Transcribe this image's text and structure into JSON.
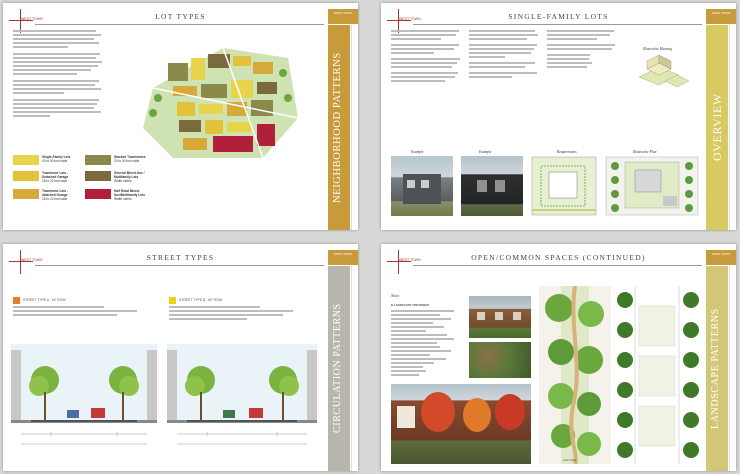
{
  "pages": {
    "lot_types": {
      "title": "LOT TYPES",
      "compass_label": "WEST TOWN",
      "tab_header": "WEST TOWN",
      "tab_title": "NEIGHBORHOOD PATTERNS",
      "legend": [
        {
          "label": "Single-Family Lots",
          "sub": "40 to 50 foot wide",
          "color": "#e6d54b"
        },
        {
          "label": "Stacked Townhomes",
          "sub": "20 to 30 foot wide",
          "color": "#8c8a4b"
        },
        {
          "label": "Townhome Lots - Detached Garage",
          "sub": "18 to 22 foot wide",
          "color": "#e4c13a"
        },
        {
          "label": "General Mixed-Use / Multifamily Lots",
          "sub": "Width varies",
          "color": "#7a6a3c"
        },
        {
          "label": "Townhome Lots - Attached Garage",
          "sub": "18 to 22 foot wide",
          "color": "#d5a93a"
        },
        {
          "label": "Half Road Mixed-Use/Multifamily Lots",
          "sub": "Width varies",
          "color": "#b0203a"
        }
      ]
    },
    "single_family": {
      "title": "SINGLE-FAMILY LOTS",
      "compass_label": "WEST TOWN",
      "tab_header": "WEST TOWN",
      "tab_title": "OVERVIEW",
      "captions": [
        "Example",
        "Example",
        "Requirements",
        "Illustrative Plan"
      ],
      "massing_caption": "Illustrative Massing"
    },
    "street_types": {
      "title": "STREET TYPES",
      "compass_label": "WEST TOWN",
      "tab_header": "WEST TOWN",
      "tab_title": "CIRCULATION PATTERNS",
      "sections": [
        {
          "label": "STREET TYPE A - 54' ROW",
          "color": "#e57e2a"
        },
        {
          "label": "STREET TYPE B - 60' ROW",
          "color": "#f2d11a"
        }
      ]
    },
    "open_spaces": {
      "title": "OPEN/COMMON SPACES (CONTINUED)",
      "compass_label": "WEST TOWN",
      "tab_header": "WEST TOWN",
      "tab_title": "LANDSCAPE PATTERNS",
      "side_header": "Notes",
      "side_subhead": "B-LANDSCAPE TREATMENT",
      "plan_label": "Green Way"
    }
  }
}
